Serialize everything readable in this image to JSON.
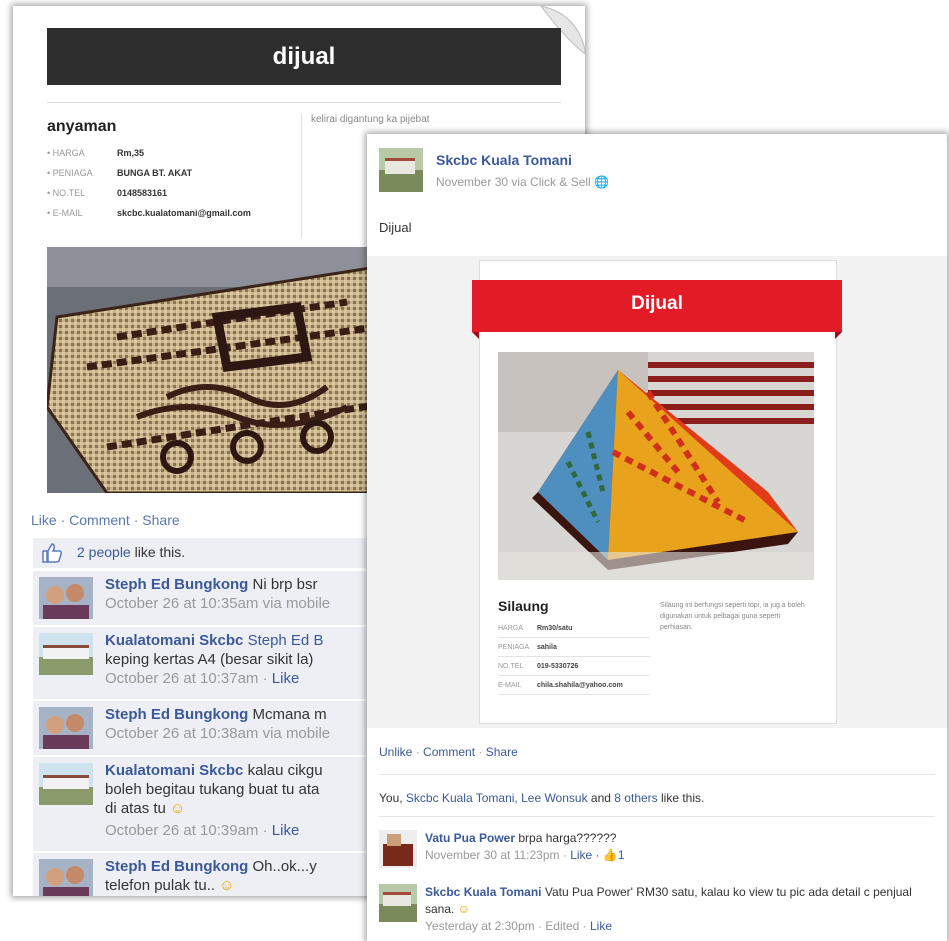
{
  "listing": {
    "banner": "dijual",
    "title": "anyaman",
    "side_note": "kelirai digantung ka pijebat",
    "fields": [
      {
        "label": "HARGA",
        "value": "Rm,35"
      },
      {
        "label": "PENIAGA",
        "value": "BUNGA BT. AKAT"
      },
      {
        "label": "NO.TEL",
        "value": "0148583161"
      },
      {
        "label": "E-MAIL",
        "value": "skcbc.kualatomani@gmail.com"
      }
    ]
  },
  "back_post": {
    "actions": {
      "like": "Like",
      "comment": "Comment",
      "share": "Share",
      "sep": " · "
    },
    "likes": {
      "count": "2 people",
      "suffix": "like this."
    },
    "comments": [
      {
        "name": "Steph Ed Bungkong",
        "text": "Ni brp bsr",
        "meta": "October 26 at 10:35am via mobile"
      },
      {
        "name": "Kualatomani Skcbc",
        "text": "Steph Ed B",
        "text2": "keping kertas A4 (besar sikit la)",
        "meta": "October 26 at 10:37am · ",
        "like": "Like"
      },
      {
        "name": "Steph Ed Bungkong",
        "text": "Mcmana m",
        "meta": "October 26 at 10:38am via mobile"
      },
      {
        "name": "Kualatomani Skcbc",
        "text": "kalau cikgu",
        "text2": "boleh begitau tukang buat tu ata",
        "text3": "di atas tu",
        "meta": "October 26 at 10:39am · ",
        "like": "Like"
      },
      {
        "name": "Steph Ed Bungkong",
        "text": "Oh..ok...y",
        "text2": "telefon pulak tu.."
      }
    ]
  },
  "front_post": {
    "page_name": "Skcbc Kuala Tomani",
    "meta": "November 30 via Click & Sell",
    "text": "Dijual",
    "listing": {
      "banner": "Dijual",
      "title": "Silaung",
      "description": "Silaung ini berfungsi seperti topi, ia jug a boleh digunakan untuk pelbagai guna seperti perhiasan.",
      "fields": [
        {
          "label": "HARGA",
          "value": "Rm30/satu"
        },
        {
          "label": "PENIAGA",
          "value": "sahila"
        },
        {
          "label": "NO.TEL",
          "value": "019-5330726"
        },
        {
          "label": "E-MAIL",
          "value": "chila.shahila@yahoo.com"
        }
      ]
    },
    "actions": {
      "unlike": "Unlike",
      "comment": "Comment",
      "share": "Share",
      "sep": " · "
    },
    "likes": {
      "you": "You, ",
      "names": "Skcbc Kuala Tomani, Lee Wonsuk",
      "and": " and ",
      "others": "8 others",
      "suffix": " like this."
    },
    "comments": [
      {
        "name": "Vatu Pua Power",
        "text": "brpa harga??????",
        "meta": "November 30 at 11:23pm · ",
        "like": "Like",
        "like_count": "1"
      },
      {
        "name": "Skcbc Kuala Tomani",
        "text": "Vatu Pua Power' RM30 satu, kalau ko view tu pic ada detail c penjual sana.",
        "meta": "Yesterday at 2:30pm · Edited · ",
        "like": "Like"
      }
    ]
  },
  "colors": {
    "facebook_blue": "#3b5998",
    "ribbon_red": "#e31b26",
    "banner_dark": "#2d2d2d"
  }
}
